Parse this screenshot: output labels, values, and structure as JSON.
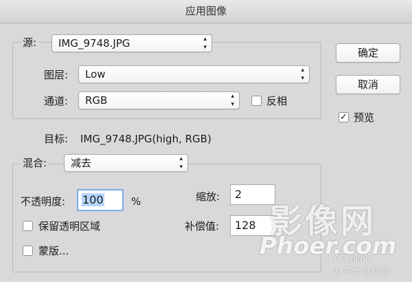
{
  "window": {
    "title": "应用图像"
  },
  "source": {
    "label": "源:",
    "file": "IMG_9748.JPG",
    "layer_label": "图层:",
    "layer": "Low",
    "channel_label": "通道:",
    "channel": "RGB",
    "invert_label": "反相",
    "invert_checked": false
  },
  "target": {
    "label": "目标:",
    "value": "IMG_9748.JPG(high, RGB)"
  },
  "blending": {
    "label": "混合:",
    "mode": "减去",
    "opacity_label": "不透明度:",
    "opacity": "100",
    "percent": "%",
    "scale_label": "缩放:",
    "scale": "2",
    "offset_label": "补偿值:",
    "offset": "128",
    "preserve_transparency_label": "保留透明区域",
    "preserve_transparency_checked": false,
    "mask_label": "蒙版...",
    "mask_checked": false
  },
  "buttons": {
    "ok": "确定",
    "cancel": "取消",
    "preview_label": "预览",
    "preview_checked": true
  },
  "watermark": {
    "big": "影像网",
    "site": "Phoer.com",
    "brand": "PConline",
    "sub": "太平洋电脑网"
  },
  "icons": {
    "checkmark": "✓",
    "updown": "▴▾"
  }
}
